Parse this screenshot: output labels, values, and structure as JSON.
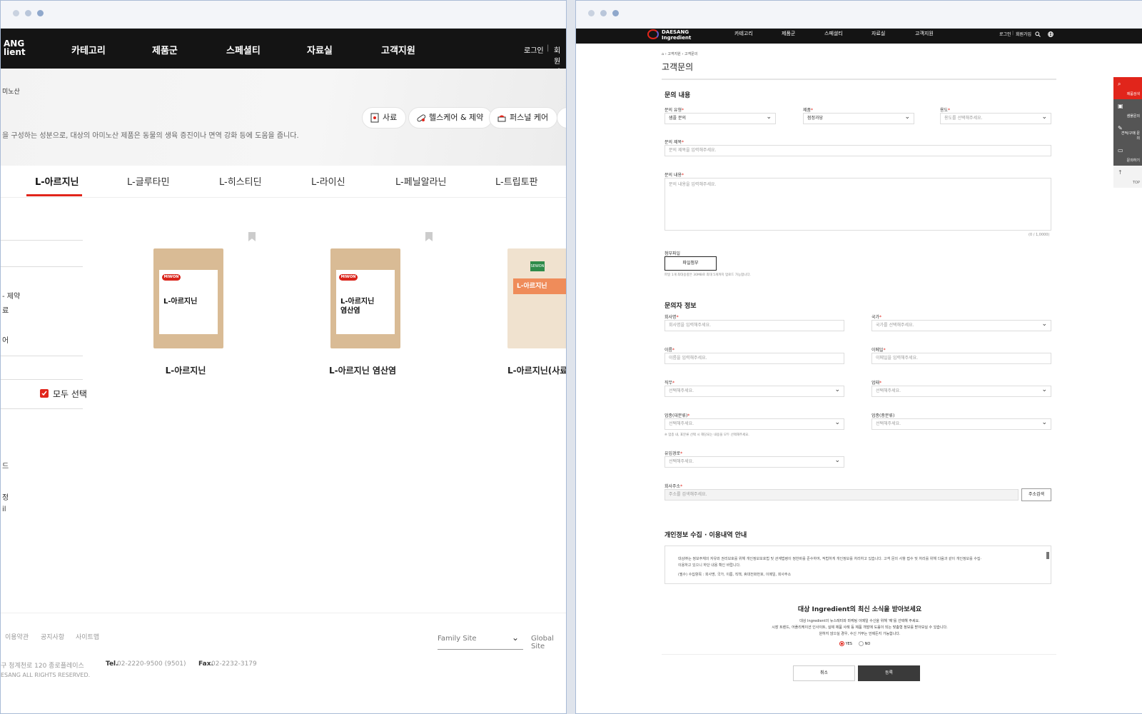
{
  "left": {
    "header": {
      "logo_line1": "ANG",
      "logo_line2": "lient",
      "nav": [
        "카테고리",
        "제품군",
        "스페셜티",
        "자료실",
        "고객지원"
      ],
      "login": "로그인",
      "divider": "|",
      "join": "회원가"
    },
    "hero": {
      "breadcrumb": "미노산",
      "description": "을 구성하는 성분으로, 대상의 아미노산 제품은 동물의 생육 증진이나 면역 강화 등에 도움을 줍니다.",
      "chips": [
        "사료",
        "헬스케어 & 제약",
        "퍼스널 케어"
      ]
    },
    "tabs": [
      "L-아르지닌",
      "L-글루타민",
      "L-히스티딘",
      "L-라이신",
      "L-페닐알라닌",
      "L-트립토판"
    ],
    "sidebar": {
      "items": [
        "- 제약",
        "료",
        "어"
      ],
      "extra": [
        "드",
        "정",
        "il"
      ],
      "select_all": "모두 선택"
    },
    "products": [
      {
        "name": "L-아르지닌",
        "label": "L-아르지닌",
        "brand": "MIWON"
      },
      {
        "name": "L-아르지닌 염산염",
        "label": "L-아르지닌\n염산염",
        "brand": "MIWON"
      },
      {
        "name": "L-아르지닌(사료용",
        "label": "L-아르지닌",
        "brand": "SEWON"
      }
    ],
    "footer": {
      "links": [
        "이용약관",
        "공지사항",
        "사이트맵"
      ],
      "family_site": "Family Site",
      "global_site": "Global Site",
      "address": "구 청계천로 120 종로플레이스",
      "tel_label": "Tel.",
      "tel": "02-2220-9500 (9501)",
      "fax_label": "Fax.",
      "fax": "02-2232-3179",
      "copyright": "ESANG ALL RIGHTS RESERVED."
    }
  },
  "right": {
    "header": {
      "logo_line1": "DAESANG",
      "logo_line2": "Ingredient",
      "nav": [
        "카테고리",
        "제품군",
        "스페셜티",
        "자료실",
        "고객지원"
      ],
      "login": "로그인",
      "divider": "|",
      "join": "회원가입"
    },
    "breadcrumb": [
      "고객지원",
      "고객문의"
    ],
    "page_title": "고객문의",
    "inquiry": {
      "section_title": "문의 내용",
      "type_label": "문의 유형",
      "type_value": "샘플 문의",
      "product_label": "제품",
      "product_value": "점정과당",
      "usage_label": "용도",
      "usage_placeholder": "용도를 선택해주세요.",
      "subject_label": "문의 제목",
      "subject_placeholder": "문의 제목을 입력해주세요.",
      "content_label": "문의 내용",
      "content_placeholder": "문의 내용을 입력해주세요.",
      "counter": "(0 / 1,0000)",
      "attach_label": "첨부파일",
      "attach_button": "파일첨부",
      "attach_note": "파일 1개 최대용량은 30MB로 최대 5개까지 업로드 가능합니다."
    },
    "inquirer": {
      "section_title": "문의자 정보",
      "company_label": "회사명",
      "company_placeholder": "회사명을 입력해주세요.",
      "country_label": "국가",
      "country_placeholder": "국가를 선택해주세요.",
      "name_label": "이름",
      "name_placeholder": "이름을 입력해주세요.",
      "email_label": "이메일",
      "email_placeholder": "이메일을 입력해주세요.",
      "job_label": "직무",
      "job_placeholder": "선택해주세요.",
      "position_label": "업태",
      "position_placeholder": "선택해주세요.",
      "industry_major_label": "업종(대분류)",
      "industry_major_placeholder": "선택해주세요.",
      "industry_mid_label": "업종(중분류)",
      "industry_mid_placeholder": "선택해주세요.",
      "industry_note": "※ 업종 내, 표분류 선택 시 해당되는 내용을 모두 선택해주세요.",
      "route_label": "유입경로",
      "route_placeholder": "선택해주세요.",
      "address_label": "회사주소",
      "address_placeholder": "주소를 검색해주세요.",
      "address_button": "주소검색"
    },
    "privacy": {
      "section_title": "개인정보 수집 · 이용내역 안내",
      "text1": "대상㈜는 정보주체의 자유와 권리보호를 위해 개인정보보호법 및 관계법령이 정한바를 준수하여, 적법하게 개인정보를 처리하고 있습니다. 고객 문의 사항 접수 및 처리를 위해 다음과 같이 개인정보를 수집·",
      "text2": "이용하고 있으니 하단 내용 확인 바랍니다.",
      "text3": "(필수) 수집항목 : 회사명, 국가, 이름, 직책, 휴대전화번호, 이메일, 회사주소"
    },
    "newsletter": {
      "title": "대상 Ingredient의 최신 소식을 받아보세요",
      "line1": "대상 Ingredient의 뉴스레터와 마케팅 이메일 수신을 위해 '예'를 선택해 주세요.",
      "line2": "시장 트렌드, 어플리케이션 인사이트, 실제 제품 사례 등 제품 개발에 도움이 되는 맞춤형 정보를 받아보실 수 있습니다.",
      "line3": "원하지 않으실 경우, 수신 거부는 언제든지 가능합니다.",
      "yes": "YES",
      "no": "NO"
    },
    "buttons": {
      "cancel": "취소",
      "submit": "등록"
    },
    "quick_menu": [
      "제품검색",
      "샘플문의",
      "견적/구매 문의",
      "문의하기",
      "TOP"
    ]
  },
  "colors": {
    "accent": "#e1251b",
    "header_bg": "#141414",
    "submit_bg": "#3a3a3a"
  }
}
